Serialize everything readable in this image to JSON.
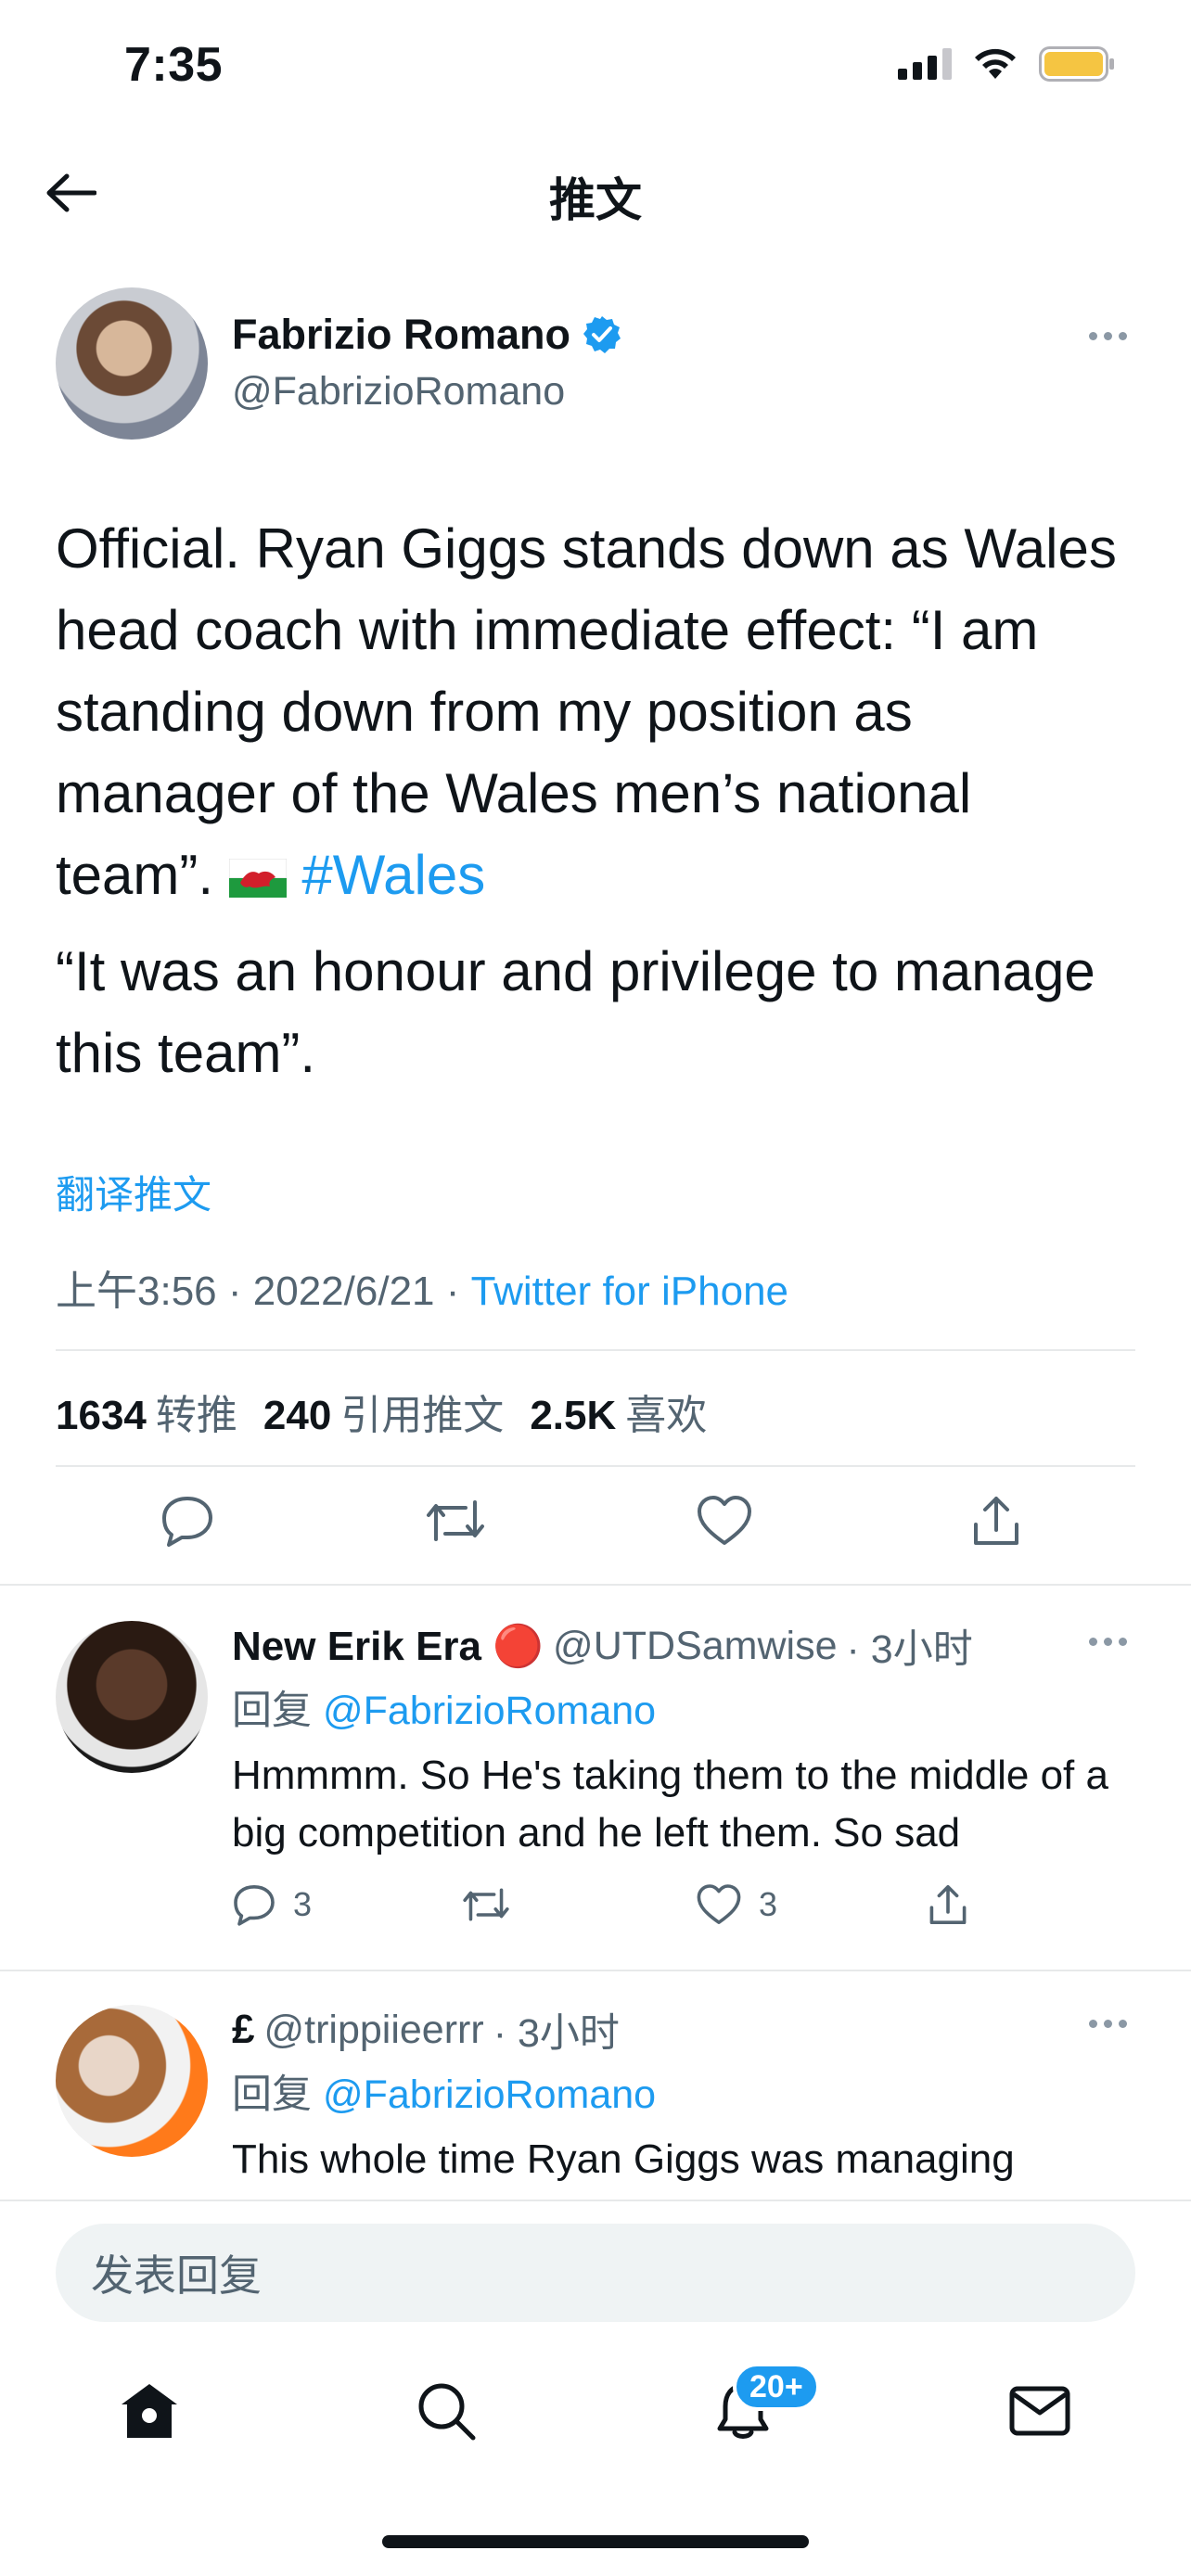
{
  "status_bar": {
    "time": "7:35",
    "icons": [
      "signal-icon",
      "wifi-icon",
      "battery-icon"
    ],
    "battery_color": "#f5c542"
  },
  "header": {
    "title": "推文",
    "back_icon": "arrow-left-icon"
  },
  "tweet": {
    "author_name": "Fabrizio Romano",
    "author_handle": "@FabrizioRomano",
    "verified": true,
    "text_main": "Official. Ryan Giggs stands down as Wales head coach with immediate effect: “I am standing down from my position as manager of the Wales men’s national team”. ",
    "flag_emoji": "wales-flag",
    "hashtag": "#Wales",
    "text_second": "“It was an honour and privilege to manage this team”.",
    "translate_label": "翻译推文",
    "time": "上午3:56",
    "date": "2022/6/21",
    "separator": "·",
    "source": "Twitter for iPhone",
    "stats": [
      {
        "count": "1634",
        "label": "转推"
      },
      {
        "count": "240",
        "label": "引用推文"
      },
      {
        "count": "2.5K",
        "label": "喜欢"
      }
    ]
  },
  "replies": [
    {
      "name": "New Erik Era 🔴",
      "handle": "@UTDSamwise",
      "time": "· 3小时",
      "reply_prefix": "回复",
      "reply_to": "@FabrizioRomano",
      "text": "Hmmmm. So He's taking them to the middle of a big competition and he left them. So sad",
      "reply_count": "3",
      "like_count": "3"
    },
    {
      "name": "£",
      "handle": "@trippiieerrr",
      "time": "· 3小时",
      "reply_prefix": "回复",
      "reply_to": "@FabrizioRomano",
      "text": "This whole time Ryan Giggs was managing"
    }
  ],
  "compose": {
    "placeholder": "发表回复"
  },
  "tab_bar": {
    "items": [
      "home-icon",
      "search-icon",
      "notifications-icon",
      "messages-icon"
    ],
    "notification_badge": "20+"
  },
  "colors": {
    "accent": "#1d9bf0",
    "text": "#0f1419",
    "secondary": "#536471"
  }
}
